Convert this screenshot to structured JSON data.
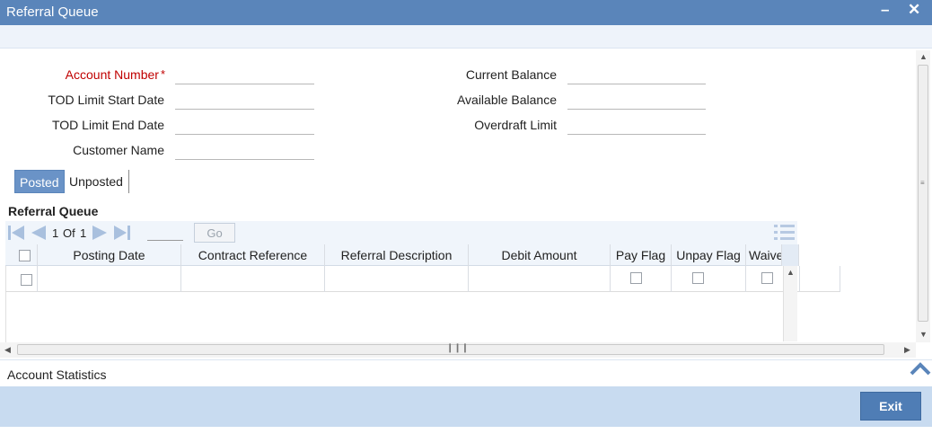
{
  "window": {
    "title": "Referral Queue",
    "minimize_glyph": "–",
    "close_glyph": "✕"
  },
  "form": {
    "account_number_label": "Account Number",
    "required_marker": "*",
    "tod_start_label": "TOD Limit Start Date",
    "tod_end_label": "TOD Limit End Date",
    "customer_name_label": "Customer Name",
    "current_balance_label": "Current Balance",
    "available_balance_label": "Available Balance",
    "overdraft_limit_label": "Overdraft Limit",
    "account_number_value": "",
    "tod_start_value": "",
    "tod_end_value": "",
    "customer_name_value": "",
    "current_balance_value": "",
    "available_balance_value": "",
    "overdraft_limit_value": ""
  },
  "tabs": [
    {
      "label": "Posted",
      "active": true
    },
    {
      "label": "Unposted",
      "active": false
    }
  ],
  "queue": {
    "section_title": "Referral Queue",
    "pager": {
      "current_page": "1",
      "of_label": "Of",
      "total_pages": "1",
      "go_label": "Go"
    },
    "columns": [
      "Posting Date",
      "Contract Reference",
      "Referral Description",
      "Debit Amount",
      "Pay Flag",
      "Unpay Flag",
      "Waive"
    ],
    "rows": [
      {
        "posting_date": "",
        "contract_reference": "",
        "referral_description": "",
        "debit_amount": ""
      }
    ]
  },
  "footer": {
    "stats_label": "Account Statistics",
    "exit_label": "Exit"
  },
  "colors": {
    "titlebar": "#5a85ba",
    "footer": "#c8dbf0",
    "required": "#c00000",
    "active_tab": "#6a93c7",
    "exit_button": "#4f7db5"
  }
}
